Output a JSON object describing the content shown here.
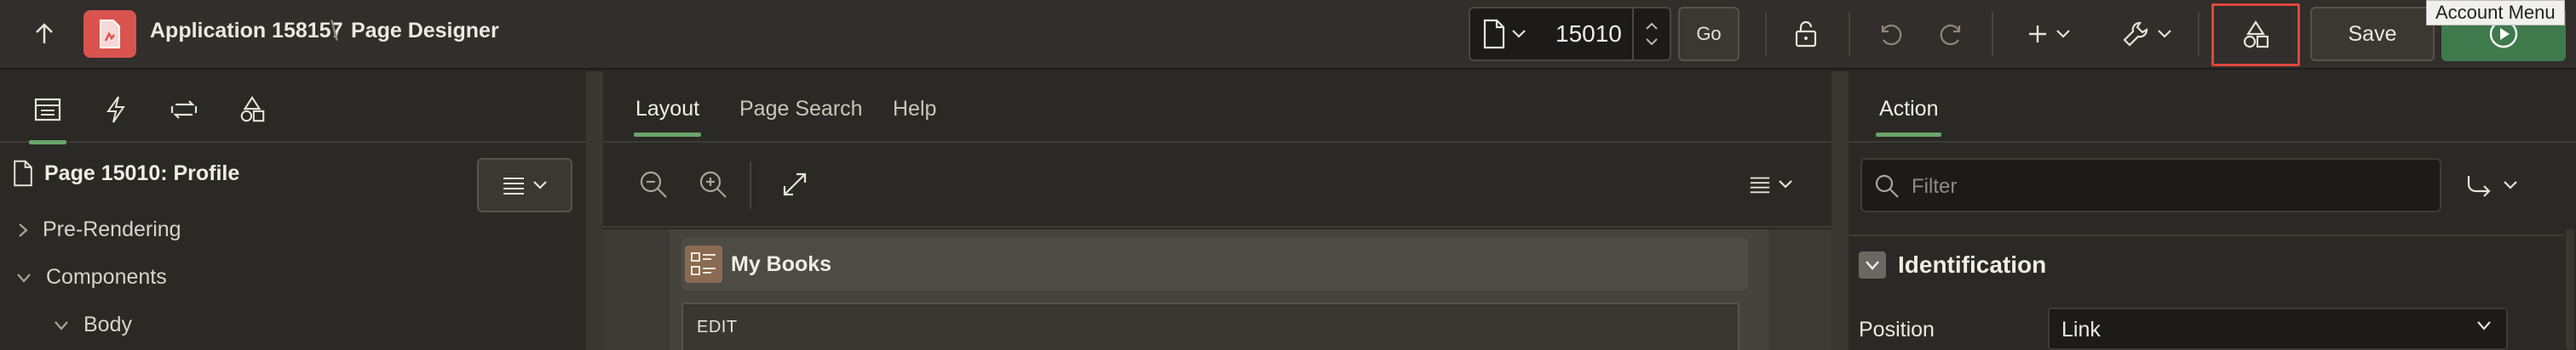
{
  "header": {
    "app_name": "Application 158157",
    "separator": "\\",
    "page_designer": "Page Designer",
    "page_number": "15010",
    "go_label": "Go",
    "save_label": "Save",
    "tooltip": "Account Menu",
    "colors": {
      "app_badge": "#d9534f",
      "run": "#3f7a4d",
      "highlight": "#e0473a",
      "accent": "#6aa56a"
    },
    "icons": [
      "up-arrow-icon",
      "app-icon",
      "page-icon",
      "lock-icon",
      "undo-icon",
      "redo-icon",
      "plus-icon",
      "wrench-icon",
      "shared-components-icon",
      "run-icon"
    ]
  },
  "left_panel": {
    "tabs": [
      "rendering-icon",
      "dynamic-actions-icon",
      "processing-icon",
      "shared-components-icon"
    ],
    "page_title": "Page 15010: Profile",
    "tree": [
      {
        "label": "Pre-Rendering",
        "expanded": false
      },
      {
        "label": "Components",
        "expanded": true
      },
      {
        "label": "Body",
        "expanded": true
      }
    ]
  },
  "center_panel": {
    "tabs": [
      {
        "label": "Layout",
        "active": true
      },
      {
        "label": "Page Search",
        "active": false
      },
      {
        "label": "Help",
        "active": false
      }
    ],
    "region_title": "My Books",
    "region_button": "EDIT"
  },
  "right_panel": {
    "tab": "Action",
    "filter_placeholder": "Filter",
    "section_title": "Identification",
    "property_label": "Position",
    "property_value": "Link"
  }
}
